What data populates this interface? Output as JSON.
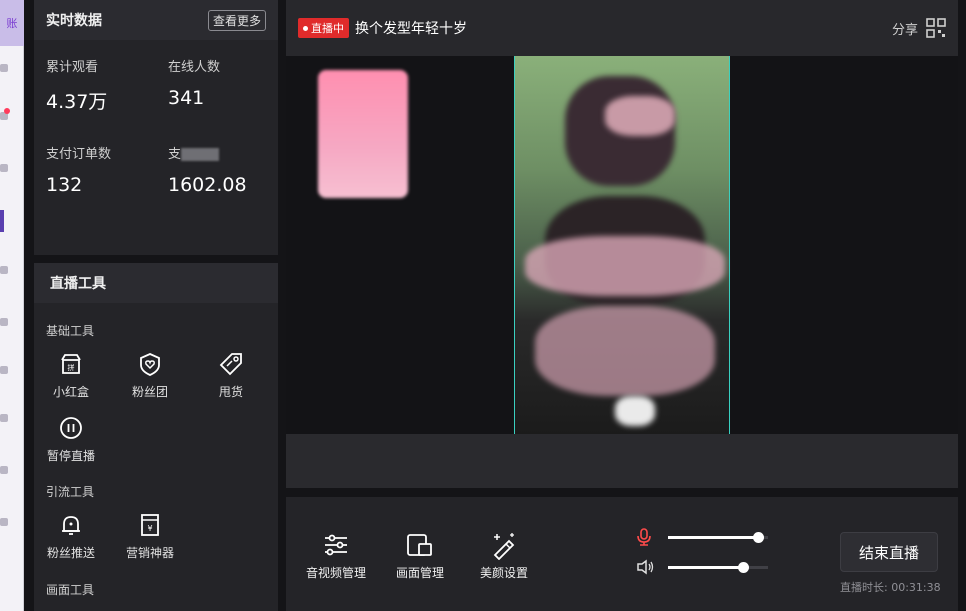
{
  "sidebar_tag": "账",
  "realtime": {
    "title": "实时数据",
    "more": "查看更多",
    "stats": [
      {
        "label": "累计观看",
        "value": "4.37万"
      },
      {
        "label": "在线人数",
        "value": "341"
      },
      {
        "label": "支付订单数",
        "value": "132"
      },
      {
        "label": "支",
        "value": "1602.08"
      }
    ]
  },
  "tools": {
    "title": "直播工具",
    "sections": {
      "basic": "基础工具",
      "traffic": "引流工具",
      "screen": "画面工具"
    },
    "basic_items": [
      "小红盒",
      "粉丝团",
      "甩货",
      "暂停直播"
    ],
    "traffic_items": [
      "粉丝推送",
      "营销神器"
    ]
  },
  "live": {
    "badge": "直播中",
    "title": "换个发型年轻十岁",
    "share": "分享"
  },
  "controls": {
    "items": [
      "音视频管理",
      "画面管理",
      "美颜设置"
    ],
    "mic_level": 0.9,
    "volume_level": 0.75,
    "end_button": "结束直播",
    "duration": "直播时长: 00:31:38"
  },
  "colors": {
    "live_red": "#e02b2b",
    "mic_red": "#ff4b4b",
    "panel": "#242428",
    "frame_border": "#3ad0c0"
  }
}
